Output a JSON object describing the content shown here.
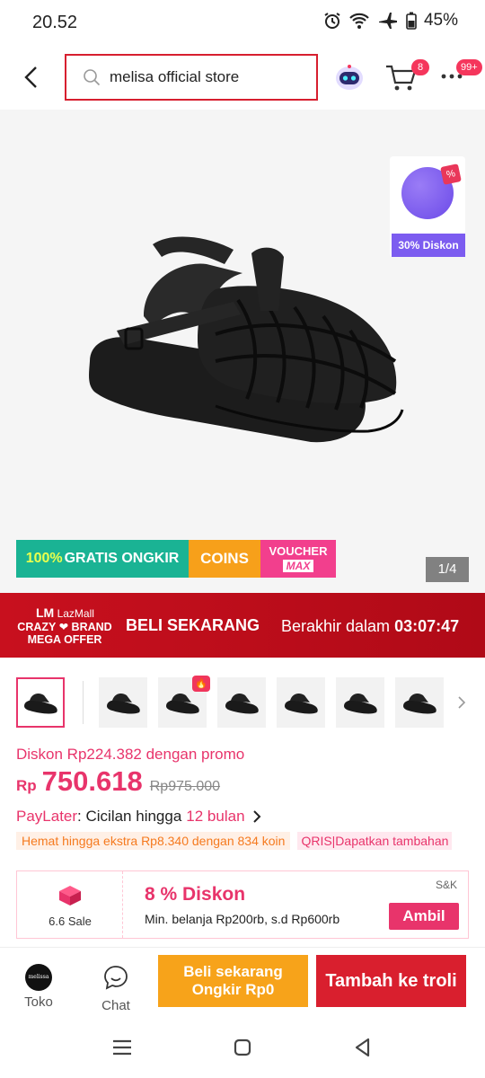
{
  "status": {
    "time": "20.52",
    "battery": "45%"
  },
  "header": {
    "search_query": "melisa official store",
    "cart_count": "8",
    "more_count": "99+"
  },
  "hero": {
    "promo_widget_label": "30% Diskon",
    "promo_widget_tag": "%",
    "benefits": {
      "ongkir_pct": "100%",
      "ongkir_text": "GRATIS ONGKIR",
      "coins": "COINS",
      "voucher": "VOUCHER",
      "voucher_max": "MAX"
    },
    "pager": "1/4"
  },
  "mega": {
    "brand": "LazMall",
    "tagline_1": "CRAZY ❤ BRAND",
    "tagline_2": "MEGA OFFER",
    "cta": "BELI SEKARANG",
    "ends_label": "Berakhir dalam",
    "countdown": "03:07:47"
  },
  "price": {
    "promo_text": "Diskon Rp224.382 dengan promo",
    "currency": "Rp",
    "current": "750.618",
    "original": "Rp975.000",
    "paylater_label": "PayLater",
    "paylater_text": ": Cicilan hingga",
    "paylater_months": "12 bulan",
    "coin_tag": "Hemat hingga ekstra Rp8.340 dengan 834 koin",
    "qris_tag": "QRIS|Dapatkan tambahan"
  },
  "voucher": {
    "event": "6.6 Sale",
    "discount": "8 % Diskon",
    "condition": "Min. belanja Rp200rb, s.d Rp600rb",
    "terms": "S&K",
    "claim": "Ambil"
  },
  "actions": {
    "store": "Toko",
    "store_logo": "melissa",
    "chat": "Chat",
    "buy_now_1": "Beli sekarang",
    "buy_now_2": "Ongkir Rp0",
    "add_cart": "Tambah ke troli"
  },
  "colors": {
    "accent": "#e8346b",
    "brand_red": "#d91f2e",
    "orange": "#f7a31a"
  }
}
